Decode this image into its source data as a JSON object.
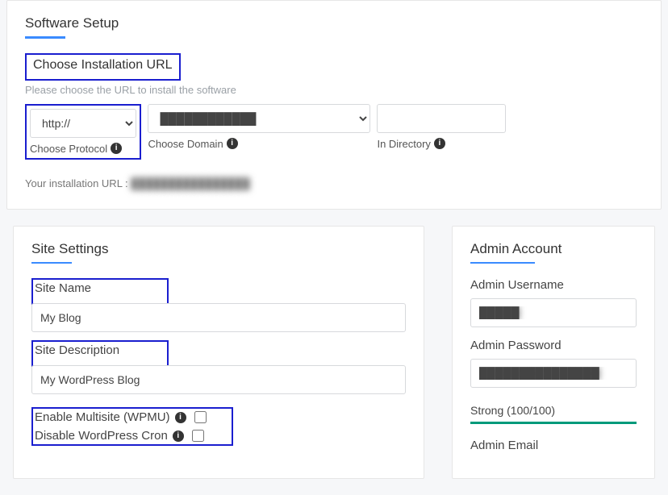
{
  "software_setup": {
    "title": "Software Setup",
    "section_heading": "Choose Installation URL",
    "sub": "Please choose the URL to install the software",
    "protocol": {
      "selected": "http://",
      "label": "Choose Protocol"
    },
    "domain": {
      "selected": "████████████",
      "label": "Choose Domain"
    },
    "directory": {
      "value": "",
      "label": "In Directory"
    },
    "install_url_label": "Your installation URL :",
    "install_url_value": "████████████████"
  },
  "site_settings": {
    "title": "Site Settings",
    "site_name": {
      "label": "Site Name",
      "value": "My Blog"
    },
    "site_desc": {
      "label": "Site Description",
      "value": "My WordPress Blog"
    },
    "multisite": {
      "label": "Enable Multisite (WPMU)",
      "checked": false
    },
    "cron": {
      "label": "Disable WordPress Cron",
      "checked": false
    }
  },
  "admin": {
    "title": "Admin Account",
    "username": {
      "label": "Admin Username",
      "value": "█████"
    },
    "password": {
      "label": "Admin Password",
      "value": "███████████████"
    },
    "strength": "Strong (100/100)",
    "email": {
      "label": "Admin Email"
    }
  }
}
